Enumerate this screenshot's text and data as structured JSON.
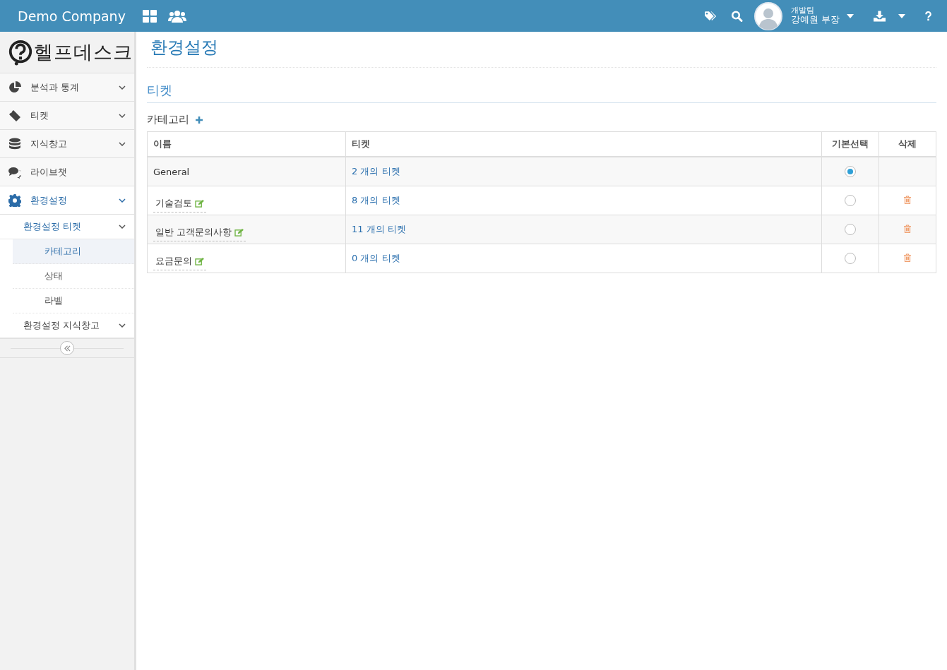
{
  "topbar": {
    "company": "Demo Company",
    "user": {
      "team": "개발팀",
      "name": "강예원 부장"
    }
  },
  "sidebar": {
    "logo": "헬프데스크",
    "items": [
      {
        "label": "분석과 통계",
        "kind": "pie",
        "has_submenu": true,
        "selected": false
      },
      {
        "label": "티켓",
        "kind": "ticket",
        "has_submenu": true,
        "selected": false
      },
      {
        "label": "지식창고",
        "kind": "database",
        "has_submenu": true,
        "selected": false
      },
      {
        "label": "라이브챗",
        "kind": "chat",
        "has_submenu": false,
        "selected": false
      },
      {
        "label": "환경설정",
        "kind": "gear",
        "has_submenu": true,
        "selected": true,
        "children": [
          {
            "label": "환경설정 티켓",
            "children": [
              {
                "label": "카테고리",
                "selected": true
              },
              {
                "label": "상태",
                "selected": false
              },
              {
                "label": "라벨",
                "selected": false
              }
            ]
          },
          {
            "label": "환경설정 지식창고"
          }
        ]
      }
    ]
  },
  "page": {
    "title": "환경설정",
    "section": "티켓",
    "subsection": "카테고리",
    "table": {
      "columns": [
        "이름",
        "티켓",
        "기본선택",
        "삭제"
      ],
      "rows": [
        {
          "name": "General",
          "editable": false,
          "tickets": "2 개의 티켓",
          "selected": true,
          "deletable": false
        },
        {
          "name": "기술검토",
          "editable": true,
          "tickets": "8 개의 티켓",
          "selected": false,
          "deletable": true
        },
        {
          "name": "일반 고객문의사항",
          "editable": true,
          "tickets": "11 개의 티켓",
          "selected": false,
          "deletable": true
        },
        {
          "name": "요금문의",
          "editable": true,
          "tickets": "0 개의 티켓",
          "selected": false,
          "deletable": true
        }
      ]
    }
  }
}
